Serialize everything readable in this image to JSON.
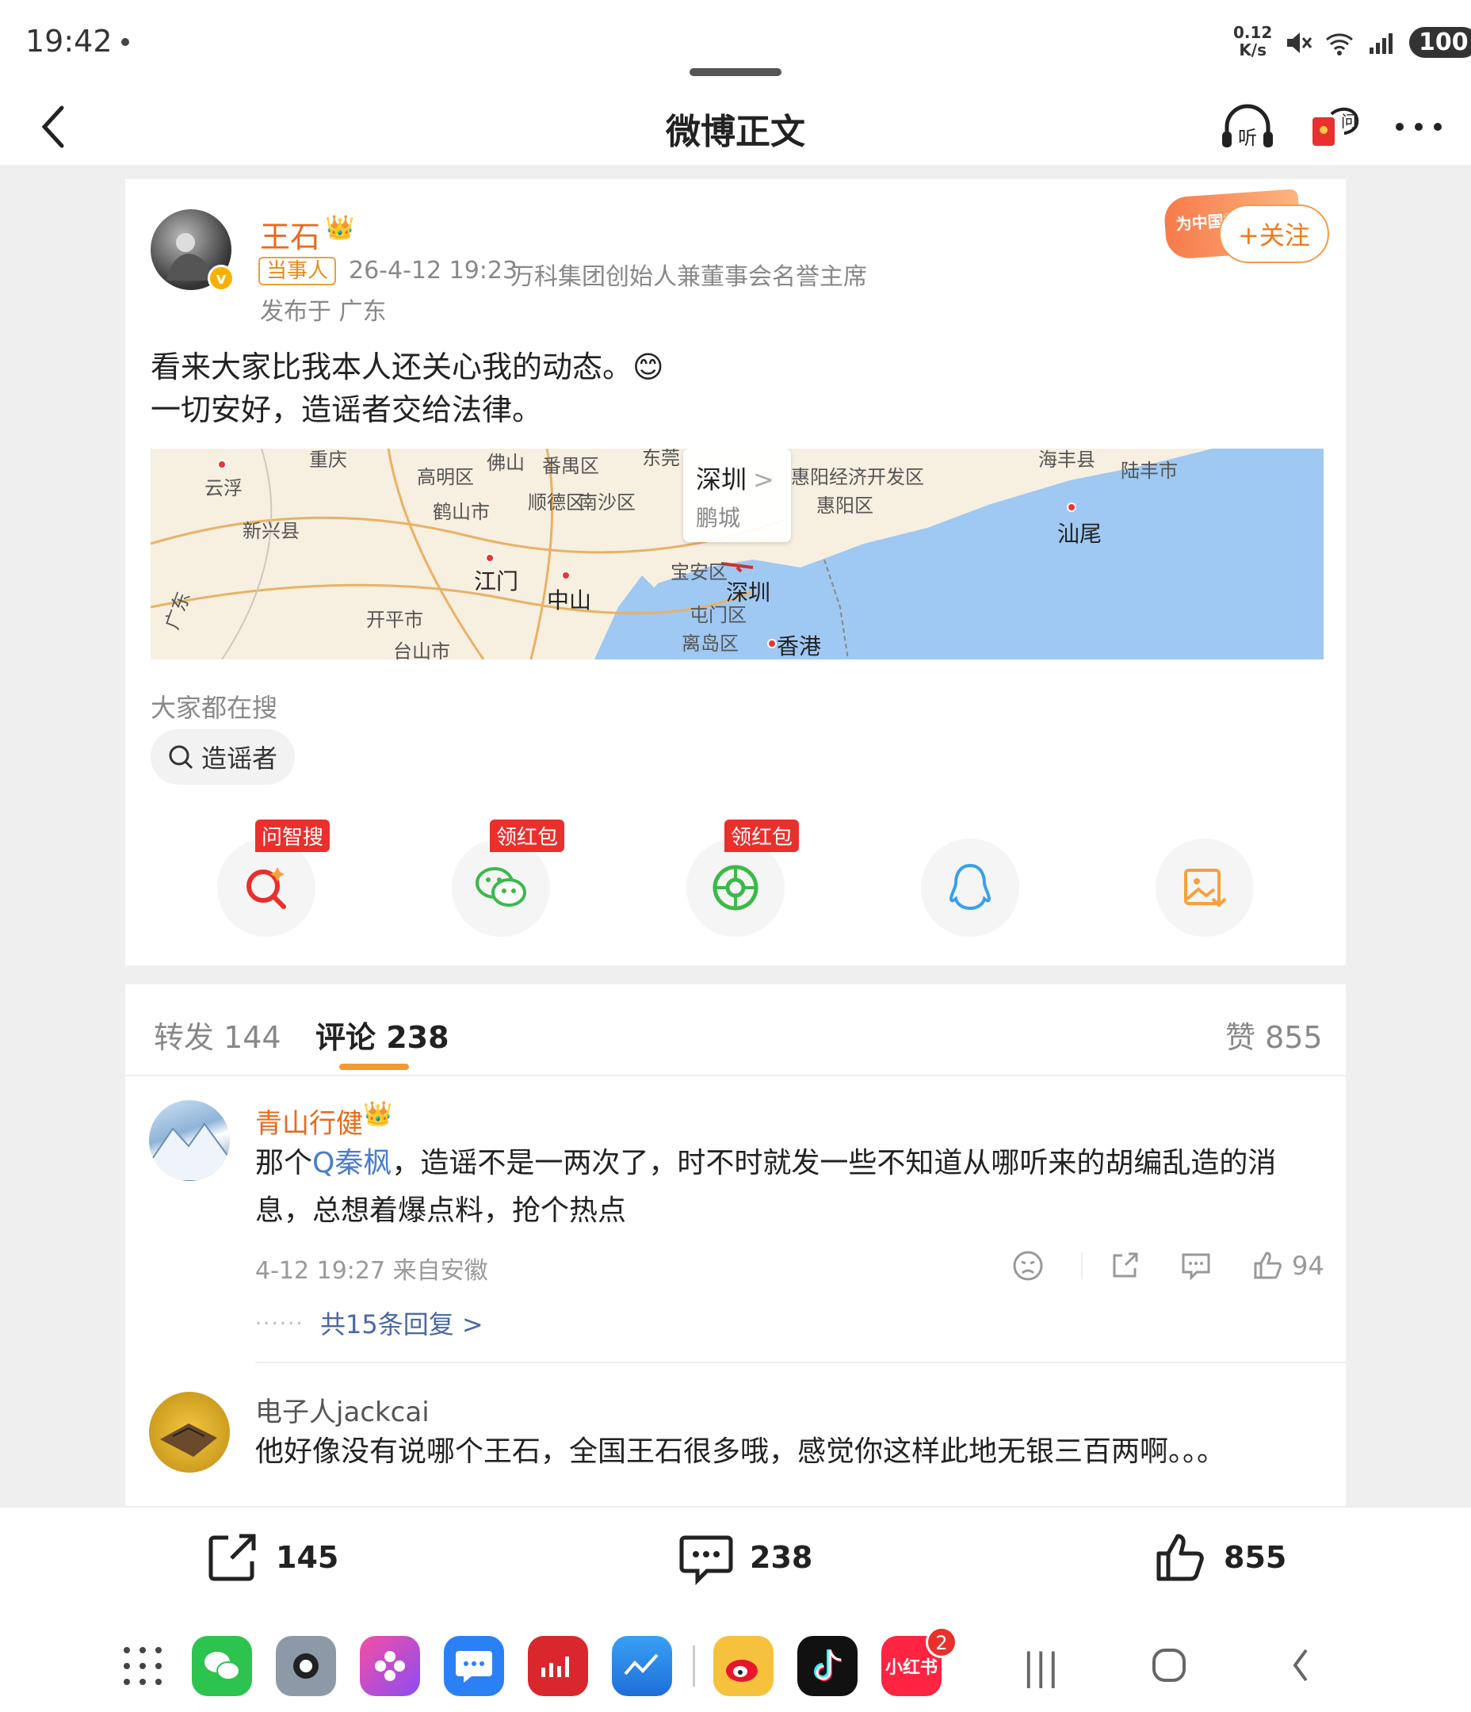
{
  "status_bar": {
    "time": "19:42",
    "net_speed_value": "0.12",
    "net_speed_unit": "K/s",
    "battery": "100"
  },
  "header": {
    "title": "微博正文"
  },
  "post": {
    "author": "王石",
    "tag": "当事人",
    "timestamp": "26-4-12 19:23",
    "author_title": "万科集团创始人兼董事会名誉主席",
    "location": "发布于 广东",
    "follow_label": "+关注",
    "banner_text": "为中国加油",
    "text_line1": "看来大家比我本人还关心我的动态。😊",
    "text_line2": "一切安好，造谣者交给法律。",
    "map": {
      "popup_city": "深圳",
      "popup_sub": "鹏城",
      "labels": [
        "重庆",
        "云浮",
        "新兴县",
        "高明区",
        "佛山",
        "番禺区",
        "东莞",
        "顺德区",
        "南沙区",
        "鹤山市",
        "江门",
        "中山",
        "开平市",
        "台山市",
        "宝安区",
        "深圳",
        "屯门区",
        "离岛区",
        "香港",
        "惠阳经济开发区",
        "惠阳区",
        "海丰县",
        "陆丰市",
        "汕尾",
        "广东"
      ]
    },
    "search_section_title": "大家都在搜",
    "search_chip": "造谣者",
    "share_tags": [
      "问智搜",
      "领红包",
      "领红包"
    ]
  },
  "comments": {
    "tabs": [
      {
        "label": "转发 144"
      },
      {
        "label": "评论 238"
      }
    ],
    "likes_label": "赞 855",
    "items": [
      {
        "name": "青山行健",
        "text_prefix": "那个",
        "text_link": "Q秦枫",
        "text_line1_rest": "，造谣不是一两次了，时不时就发一些不知道从哪听来的胡编乱造的消",
        "text_line2": "息，总想着爆点料，抢个热点",
        "meta": "4-12 19:27  来自安徽",
        "like_count": "94",
        "replies_label": "共15条回复 >",
        "dots": "......"
      },
      {
        "name": "电子人jackcai",
        "text": "他好像没有说哪个王石，全国王石很多哦，感觉你这样此地无银三百两啊。。。"
      }
    ]
  },
  "action_bar": {
    "repost_count": "145",
    "comment_count": "238",
    "like_count": "855"
  },
  "dock": {
    "xiaohongshu_label": "小红书",
    "xiaohongshu_badge": "2"
  }
}
